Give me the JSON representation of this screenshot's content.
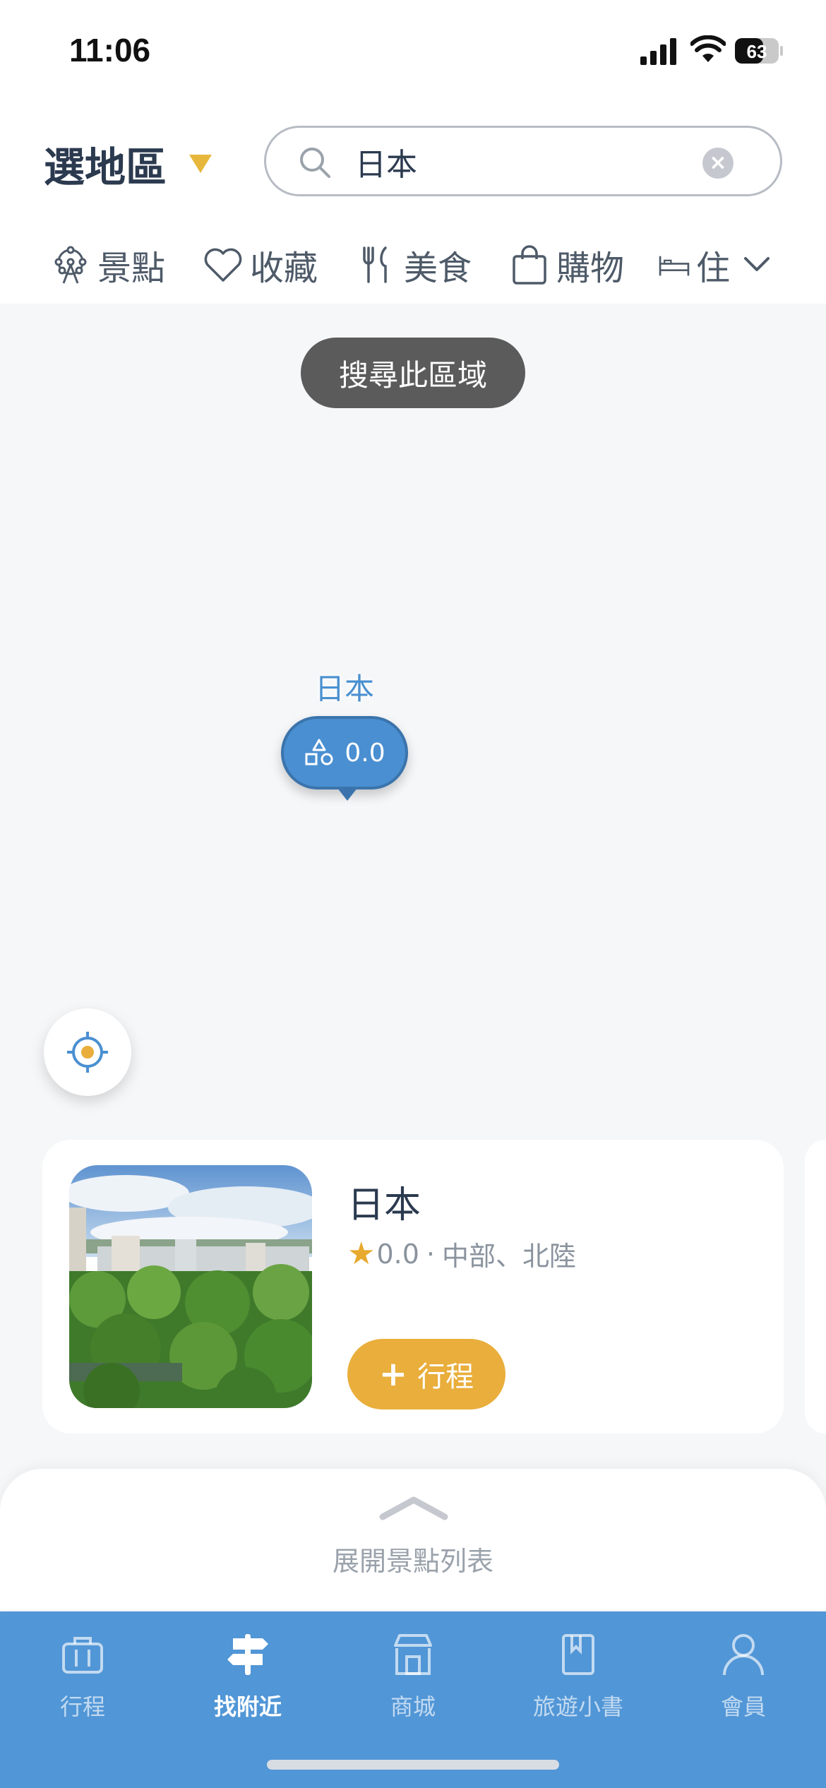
{
  "status_bar": {
    "time": "11:06",
    "battery": "63"
  },
  "header": {
    "region_label": "選地區",
    "search": {
      "value": "日本",
      "placeholder": ""
    },
    "categories": [
      {
        "label": "景點",
        "icon": "ferris-wheel-icon"
      },
      {
        "label": "收藏",
        "icon": "heart-icon"
      },
      {
        "label": "美食",
        "icon": "fork-knife-icon"
      },
      {
        "label": "購物",
        "icon": "shopping-bag-icon"
      },
      {
        "label": "住",
        "icon": "bed-icon"
      }
    ]
  },
  "map": {
    "search_area_label": "搜尋此區域",
    "marker": {
      "name": "日本",
      "value": "0.0"
    }
  },
  "place_card": {
    "name": "日本",
    "rating": "0.0",
    "separator": "·",
    "region": "中部、北陸",
    "add_label": "行程"
  },
  "sheet": {
    "expand_label": "展開景點列表"
  },
  "tabbar": {
    "tabs": [
      {
        "label": "行程",
        "icon": "suitcase-icon"
      },
      {
        "label": "找附近",
        "icon": "signpost-icon",
        "active": true
      },
      {
        "label": "商城",
        "icon": "store-icon"
      },
      {
        "label": "旅遊小書",
        "icon": "book-icon"
      },
      {
        "label": "會員",
        "icon": "user-icon"
      }
    ]
  },
  "colors": {
    "accent_blue": "#5196d6",
    "accent_yellow": "#e9ae3b",
    "marker_blue": "#4a8fd1",
    "text_dark": "#2b3a4f"
  }
}
